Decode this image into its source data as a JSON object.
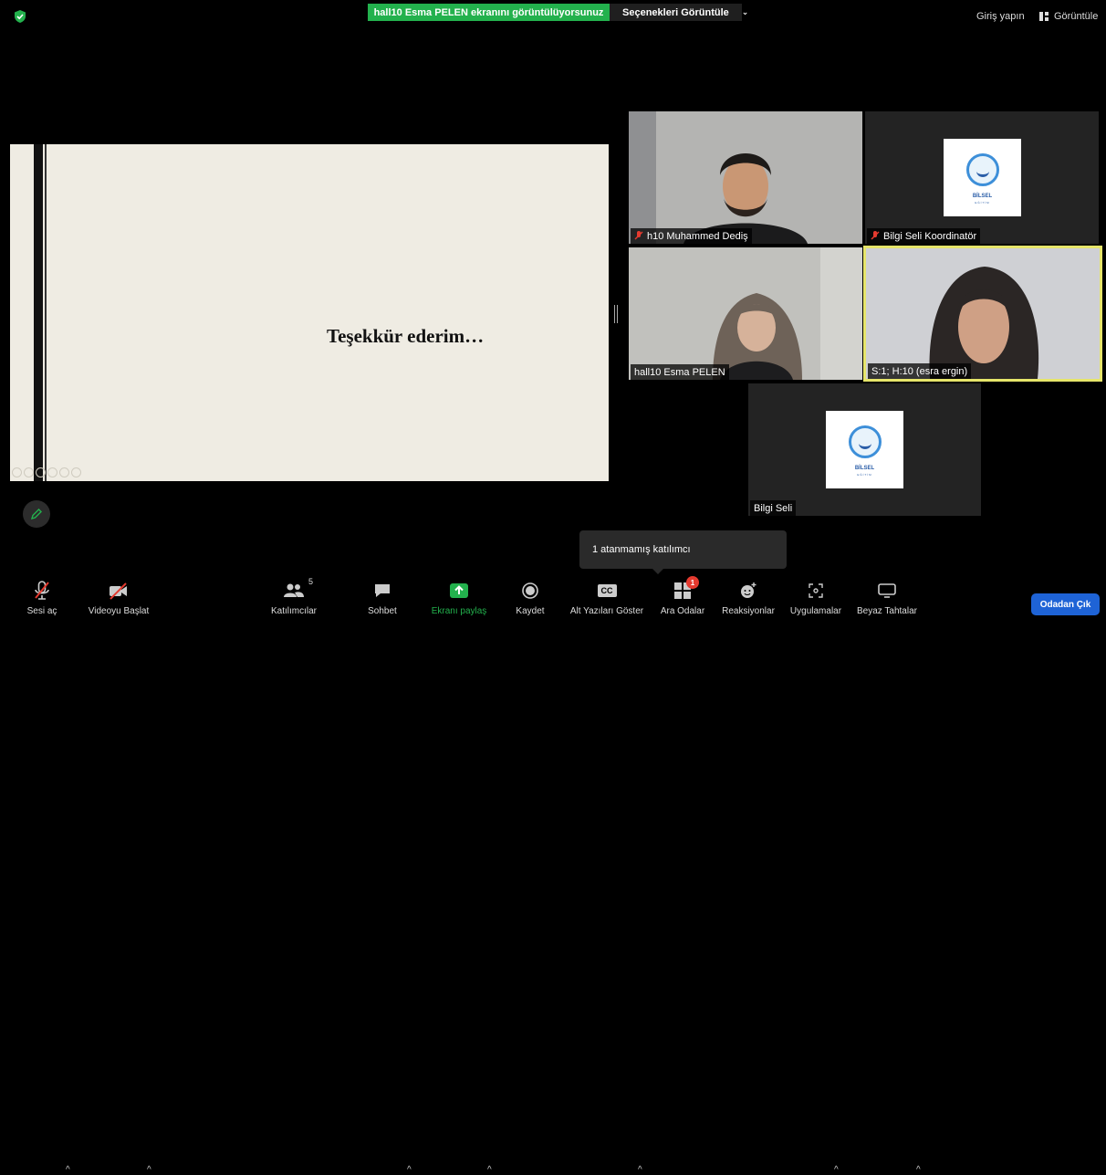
{
  "top_bar": {
    "share_banner": "hall10 Esma PELEN ekranını görüntülüyorsunuz",
    "view_options": "Seçenekleri Görüntüle",
    "sign_in": "Giriş yapın",
    "view_button": "Görüntüle"
  },
  "shared_screen": {
    "slide_text": "Teşekkür ederim…"
  },
  "participants": [
    {
      "name": "h10 Muhammed Dediş",
      "muted": true
    },
    {
      "name": "Bilgi Seli Koordinatör",
      "muted": true,
      "logo_text": "BİLSEL",
      "logo_subtext": "EĞİTİM"
    },
    {
      "name": "hall10 Esma PELEN",
      "muted": false
    },
    {
      "name": "S:1; H:10 (esra ergin)",
      "muted": false,
      "active_speaker": true
    },
    {
      "name": "Bilgi Seli",
      "muted": false,
      "logo_text": "BİLSEL",
      "logo_subtext": "EĞİTİM"
    }
  ],
  "tooltip": "1 atanmamış katılımcı",
  "toolbar": {
    "unmute": "Sesi aç",
    "start_video": "Videoyu Başlat",
    "participants": "Katılımcılar",
    "participants_count": "5",
    "chat": "Sohbet",
    "share_screen": "Ekranı paylaş",
    "record": "Kaydet",
    "captions": "Alt Yazıları Göster",
    "captions_icon_text": "CC",
    "breakout": "Ara Odalar",
    "breakout_badge": "1",
    "reactions": "Reaksiyonlar",
    "apps": "Uygulamalar",
    "whiteboard": "Beyaz Tahtalar",
    "leave": "Odadan Çık"
  },
  "colors": {
    "share_banner": "#23b14d",
    "active_speaker_border": "#e6e56a",
    "leave_button": "#1e63d6",
    "badge": "#e53a2f"
  }
}
